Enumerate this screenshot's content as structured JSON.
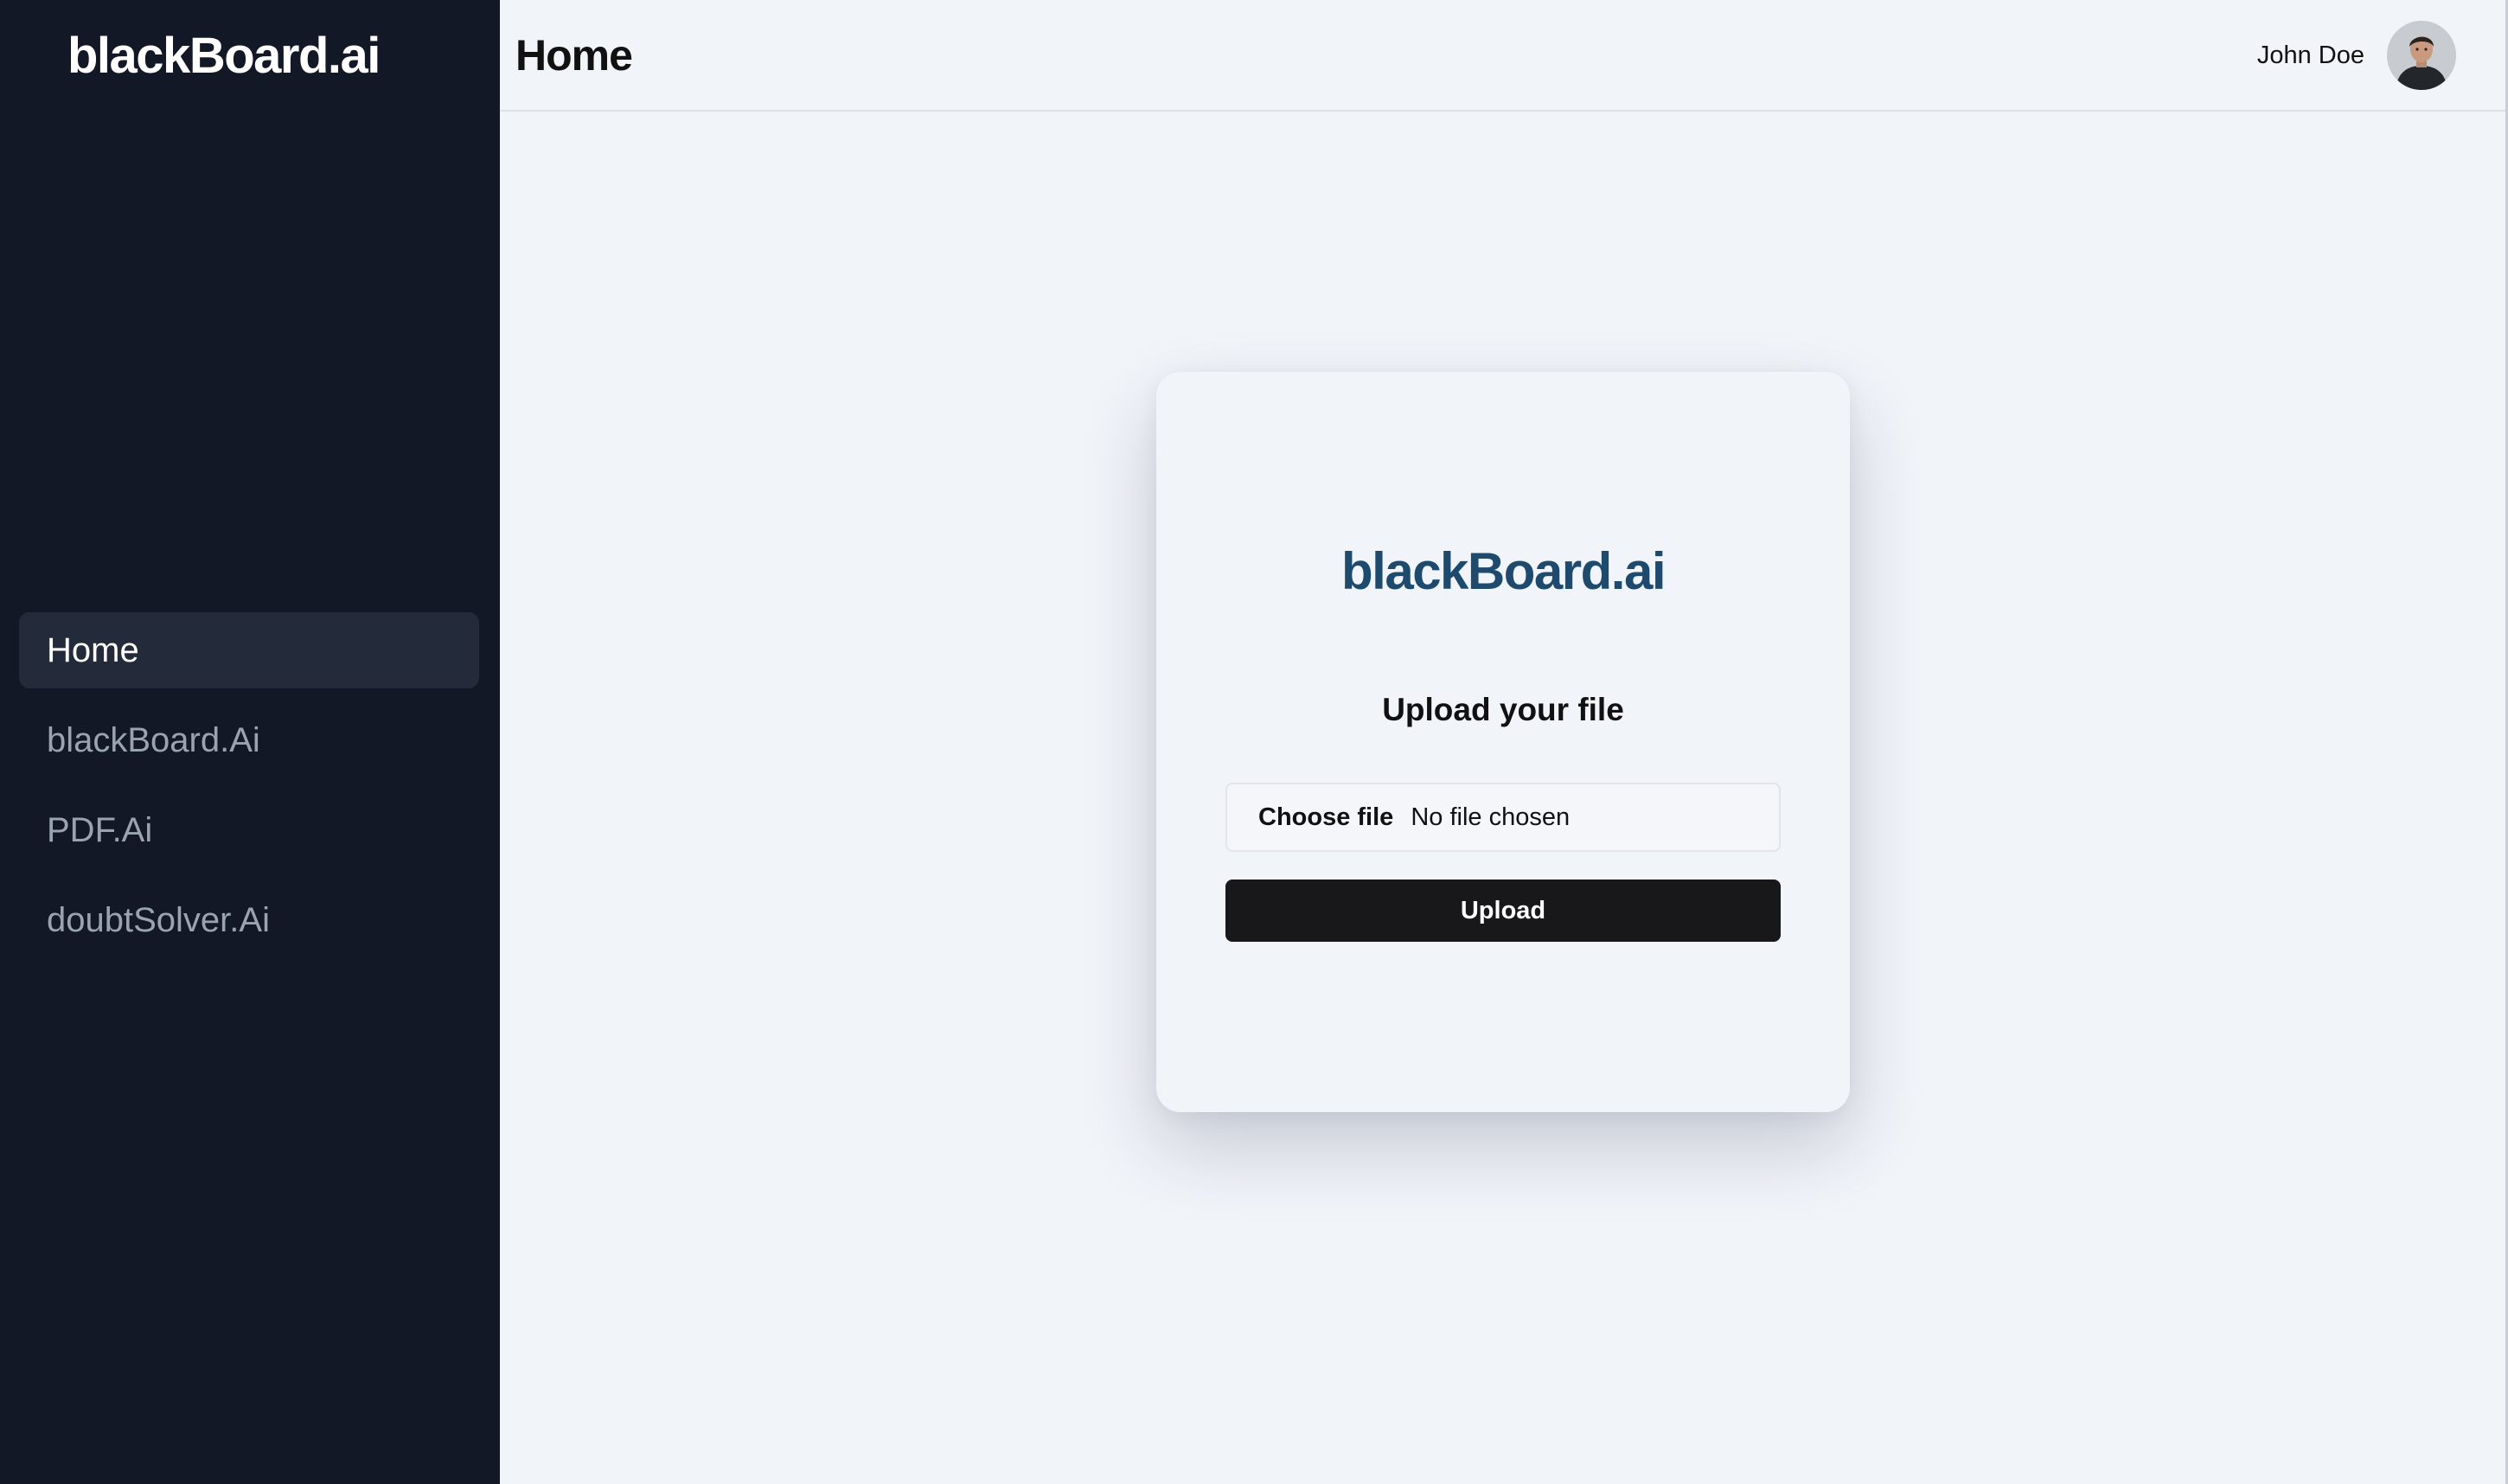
{
  "sidebar": {
    "logo": "blackBoard.ai",
    "items": [
      {
        "label": "Home",
        "active": true
      },
      {
        "label": "blackBoard.Ai",
        "active": false
      },
      {
        "label": "PDF.Ai",
        "active": false
      },
      {
        "label": "doubtSolver.Ai",
        "active": false
      }
    ]
  },
  "header": {
    "title": "Home",
    "user_name": "John Doe",
    "avatar_icon": "user-avatar"
  },
  "upload_card": {
    "logo": "blackBoard.ai",
    "heading": "Upload your file",
    "choose_file_label": "Choose file",
    "file_status": "No file chosen",
    "upload_label": "Upload"
  },
  "colors": {
    "sidebar_bg": "#121826",
    "active_item_bg": "#232a39",
    "brand_blue": "#1e4a6e",
    "button_bg": "#18181b",
    "page_bg": "#f1f4f9"
  }
}
